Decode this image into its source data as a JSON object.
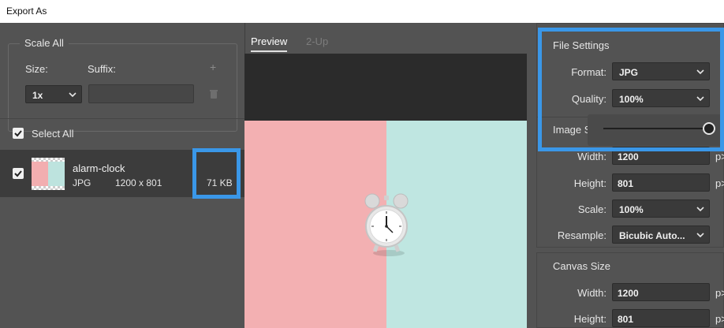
{
  "window": {
    "title": "Export As"
  },
  "scale_all": {
    "title": "Scale All",
    "size_label": "Size:",
    "suffix_label": "Suffix:",
    "size_value": "1x",
    "suffix_value": "",
    "add_symbol": "+"
  },
  "select_all": {
    "label": "Select All",
    "checked": true
  },
  "asset": {
    "name": "alarm-clock",
    "format": "JPG",
    "dimensions": "1200 x 801",
    "filesize": "71 KB",
    "checked": true
  },
  "preview": {
    "tabs": [
      {
        "label": "Preview",
        "active": true
      },
      {
        "label": "2-Up",
        "active": false
      }
    ]
  },
  "file_settings": {
    "title": "File Settings",
    "format_label": "Format:",
    "format_value": "JPG",
    "quality_label": "Quality:",
    "quality_value": "100%",
    "quality_slider": 1.0
  },
  "image_size": {
    "title_partial": "Image S",
    "width_label": "Width:",
    "width_value": "1200",
    "height_label": "Height:",
    "height_value": "801",
    "scale_label": "Scale:",
    "scale_value": "100%",
    "resample_label": "Resample:",
    "resample_value": "Bicubic Auto...",
    "unit_partial": "p>"
  },
  "canvas_size": {
    "title": "Canvas Size",
    "width_label": "Width:",
    "width_value": "1200",
    "height_label": "Height:",
    "height_value": "801",
    "unit_partial": "p>"
  },
  "colors": {
    "highlight": "#3a97e8",
    "panel": "#535353",
    "field": "#3a3a3a"
  }
}
